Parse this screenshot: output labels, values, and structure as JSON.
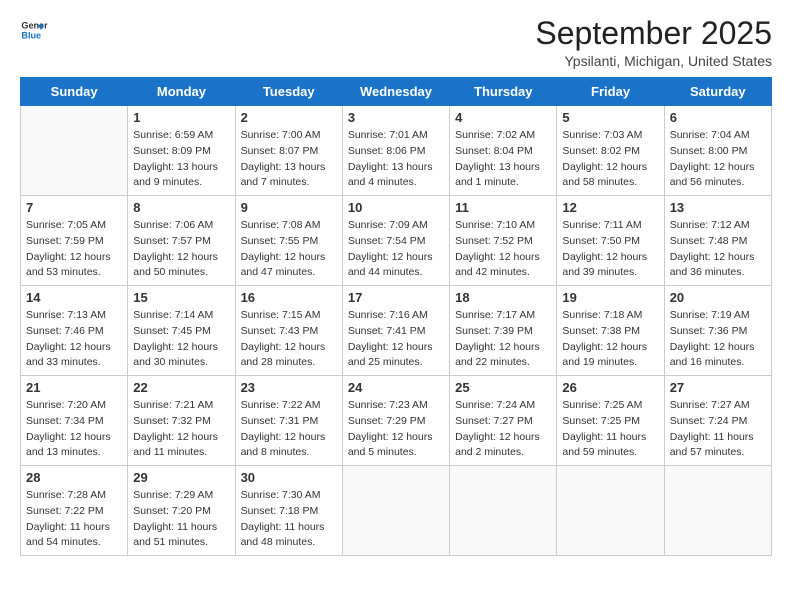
{
  "logo": {
    "line1": "General",
    "line2": "Blue"
  },
  "title": "September 2025",
  "location": "Ypsilanti, Michigan, United States",
  "weekdays": [
    "Sunday",
    "Monday",
    "Tuesday",
    "Wednesday",
    "Thursday",
    "Friday",
    "Saturday"
  ],
  "weeks": [
    [
      {
        "day": null
      },
      {
        "day": "1",
        "sunrise": "6:59 AM",
        "sunset": "8:09 PM",
        "daylight": "13 hours and 9 minutes."
      },
      {
        "day": "2",
        "sunrise": "7:00 AM",
        "sunset": "8:07 PM",
        "daylight": "13 hours and 7 minutes."
      },
      {
        "day": "3",
        "sunrise": "7:01 AM",
        "sunset": "8:06 PM",
        "daylight": "13 hours and 4 minutes."
      },
      {
        "day": "4",
        "sunrise": "7:02 AM",
        "sunset": "8:04 PM",
        "daylight": "13 hours and 1 minute."
      },
      {
        "day": "5",
        "sunrise": "7:03 AM",
        "sunset": "8:02 PM",
        "daylight": "12 hours and 58 minutes."
      },
      {
        "day": "6",
        "sunrise": "7:04 AM",
        "sunset": "8:00 PM",
        "daylight": "12 hours and 56 minutes."
      }
    ],
    [
      {
        "day": "7",
        "sunrise": "7:05 AM",
        "sunset": "7:59 PM",
        "daylight": "12 hours and 53 minutes."
      },
      {
        "day": "8",
        "sunrise": "7:06 AM",
        "sunset": "7:57 PM",
        "daylight": "12 hours and 50 minutes."
      },
      {
        "day": "9",
        "sunrise": "7:08 AM",
        "sunset": "7:55 PM",
        "daylight": "12 hours and 47 minutes."
      },
      {
        "day": "10",
        "sunrise": "7:09 AM",
        "sunset": "7:54 PM",
        "daylight": "12 hours and 44 minutes."
      },
      {
        "day": "11",
        "sunrise": "7:10 AM",
        "sunset": "7:52 PM",
        "daylight": "12 hours and 42 minutes."
      },
      {
        "day": "12",
        "sunrise": "7:11 AM",
        "sunset": "7:50 PM",
        "daylight": "12 hours and 39 minutes."
      },
      {
        "day": "13",
        "sunrise": "7:12 AM",
        "sunset": "7:48 PM",
        "daylight": "12 hours and 36 minutes."
      }
    ],
    [
      {
        "day": "14",
        "sunrise": "7:13 AM",
        "sunset": "7:46 PM",
        "daylight": "12 hours and 33 minutes."
      },
      {
        "day": "15",
        "sunrise": "7:14 AM",
        "sunset": "7:45 PM",
        "daylight": "12 hours and 30 minutes."
      },
      {
        "day": "16",
        "sunrise": "7:15 AM",
        "sunset": "7:43 PM",
        "daylight": "12 hours and 28 minutes."
      },
      {
        "day": "17",
        "sunrise": "7:16 AM",
        "sunset": "7:41 PM",
        "daylight": "12 hours and 25 minutes."
      },
      {
        "day": "18",
        "sunrise": "7:17 AM",
        "sunset": "7:39 PM",
        "daylight": "12 hours and 22 minutes."
      },
      {
        "day": "19",
        "sunrise": "7:18 AM",
        "sunset": "7:38 PM",
        "daylight": "12 hours and 19 minutes."
      },
      {
        "day": "20",
        "sunrise": "7:19 AM",
        "sunset": "7:36 PM",
        "daylight": "12 hours and 16 minutes."
      }
    ],
    [
      {
        "day": "21",
        "sunrise": "7:20 AM",
        "sunset": "7:34 PM",
        "daylight": "12 hours and 13 minutes."
      },
      {
        "day": "22",
        "sunrise": "7:21 AM",
        "sunset": "7:32 PM",
        "daylight": "12 hours and 11 minutes."
      },
      {
        "day": "23",
        "sunrise": "7:22 AM",
        "sunset": "7:31 PM",
        "daylight": "12 hours and 8 minutes."
      },
      {
        "day": "24",
        "sunrise": "7:23 AM",
        "sunset": "7:29 PM",
        "daylight": "12 hours and 5 minutes."
      },
      {
        "day": "25",
        "sunrise": "7:24 AM",
        "sunset": "7:27 PM",
        "daylight": "12 hours and 2 minutes."
      },
      {
        "day": "26",
        "sunrise": "7:25 AM",
        "sunset": "7:25 PM",
        "daylight": "11 hours and 59 minutes."
      },
      {
        "day": "27",
        "sunrise": "7:27 AM",
        "sunset": "7:24 PM",
        "daylight": "11 hours and 57 minutes."
      }
    ],
    [
      {
        "day": "28",
        "sunrise": "7:28 AM",
        "sunset": "7:22 PM",
        "daylight": "11 hours and 54 minutes."
      },
      {
        "day": "29",
        "sunrise": "7:29 AM",
        "sunset": "7:20 PM",
        "daylight": "11 hours and 51 minutes."
      },
      {
        "day": "30",
        "sunrise": "7:30 AM",
        "sunset": "7:18 PM",
        "daylight": "11 hours and 48 minutes."
      },
      {
        "day": null
      },
      {
        "day": null
      },
      {
        "day": null
      },
      {
        "day": null
      }
    ]
  ]
}
